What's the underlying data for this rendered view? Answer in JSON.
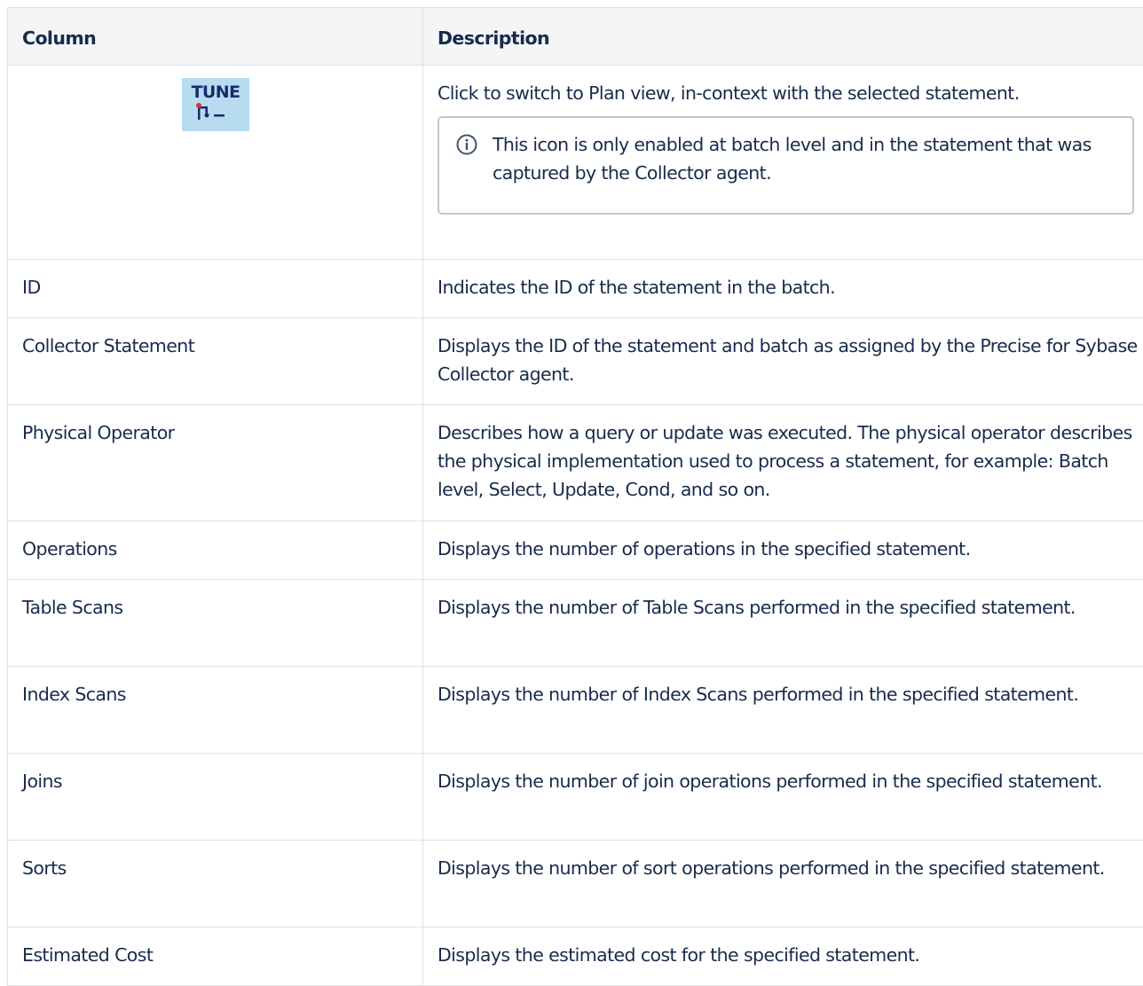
{
  "table": {
    "headers": [
      "Column",
      "Description"
    ],
    "icon_row": {
      "icon": "tune-icon",
      "icon_text": "TUNE",
      "description": "Click to switch to Plan view, in-context with the selected statement.",
      "note_icon": "info-icon",
      "note": "This icon is only enabled at batch level and in the statement that was captured by the Collector agent."
    },
    "rows": [
      {
        "column": "ID",
        "description": "Indicates the ID of the statement in the batch."
      },
      {
        "column": "Collector Statement",
        "description": "Displays the ID of the statement and batch as assigned by the Precise for Sybase Collector agent."
      },
      {
        "column": "Physical Operator",
        "description": "Describes how a query or update was executed. The physical operator describes the physical implementation used to process a statement, for example: Batch level, Select, Update, Cond, and so on."
      },
      {
        "column": "Operations",
        "description": "Displays the number of operations in the specified statement."
      },
      {
        "column": "Table Scans",
        "description": "Displays the number of Table Scans performed in the specified statement."
      },
      {
        "column": "Index Scans",
        "description": "Displays the number of Index Scans performed in the specified statement."
      },
      {
        "column": "Joins",
        "description": "Displays the number of join operations performed in the specified statement."
      },
      {
        "column": "Sorts",
        "description": "Displays the number of sort operations performed in the specified statement."
      },
      {
        "column": "Estimated Cost",
        "description": "Displays the estimated cost for the specified statement."
      }
    ]
  }
}
